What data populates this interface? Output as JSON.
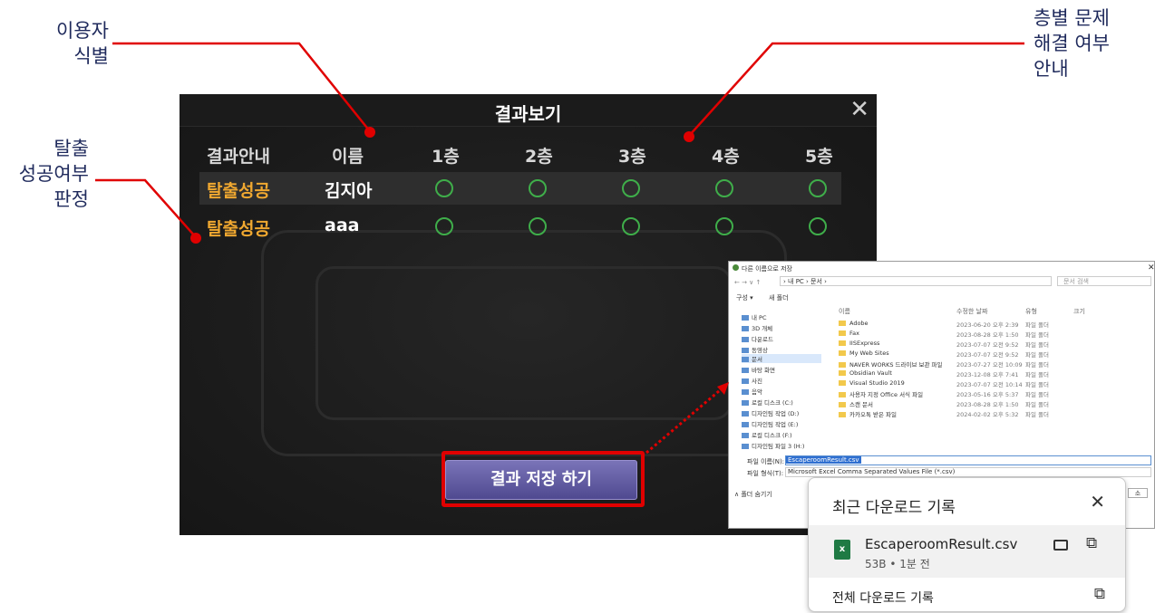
{
  "callouts": {
    "user_id": [
      "이용자",
      "식별"
    ],
    "floor_status": [
      "층별 문제",
      "해결 여부",
      "안내"
    ],
    "escape_result": [
      "탈출",
      "성공여부",
      "판정"
    ]
  },
  "game": {
    "title": "결과보기",
    "close": "✕",
    "headers": [
      "결과안내",
      "이름",
      "1층",
      "2층",
      "3층",
      "4층",
      "5층"
    ],
    "rows": [
      {
        "status": "탈출성공",
        "name": "김지아",
        "floors": [
          "O",
          "O",
          "O",
          "O",
          "O"
        ]
      },
      {
        "status": "탈출성공",
        "name": "aaa",
        "floors": [
          "O",
          "O",
          "O",
          "O",
          "O"
        ]
      }
    ],
    "save_button": "결과 저장 하기",
    "colors": {
      "status": "#f0a830",
      "circle": "#3fae4a",
      "highlight": "#e00000"
    }
  },
  "dialog": {
    "title": "다른 이름으로 저장",
    "path": "› 내 PC › 문서 ›",
    "search_placeholder": "문서 검색",
    "organize": "구성 ▾",
    "new_folder": "새 폴더",
    "col_name": "이름",
    "col_modified": "수정한 날짜",
    "col_type": "유형",
    "col_size": "크기",
    "sidebar": [
      "내 PC",
      "3D 개체",
      "다운로드",
      "동영상",
      "문서",
      "바탕 화면",
      "사진",
      "음악",
      "로컬 디스크 (C:)",
      "디자인팀 작업 (D:)",
      "디자인팀 작업 (E:)",
      "로컬 디스크 (F:)",
      "디자인팀 파일 3 (H:)"
    ],
    "files": [
      {
        "name": "Adobe",
        "date": "2023-06-20 오후 2:39",
        "type": "파일 폴더"
      },
      {
        "name": "Fax",
        "date": "2023-08-28 오후 1:50",
        "type": "파일 폴더"
      },
      {
        "name": "IISExpress",
        "date": "2023-07-07 오전 9:52",
        "type": "파일 폴더"
      },
      {
        "name": "My Web Sites",
        "date": "2023-07-07 오전 9:52",
        "type": "파일 폴더"
      },
      {
        "name": "NAVER WORKS 드라이브 보관 파일",
        "date": "2023-07-27 오전 10:09",
        "type": "파일 폴더"
      },
      {
        "name": "Obsidian Vault",
        "date": "2023-12-08 오후 7:41",
        "type": "파일 폴더"
      },
      {
        "name": "Visual Studio 2019",
        "date": "2023-07-07 오전 10:14",
        "type": "파일 폴더"
      },
      {
        "name": "사용자 지정 Office 서식 파일",
        "date": "2023-05-16 오후 5:37",
        "type": "파일 폴더"
      },
      {
        "name": "스캔 문서",
        "date": "2023-08-28 오후 1:50",
        "type": "파일 폴더"
      },
      {
        "name": "카카오톡 받은 파일",
        "date": "2024-02-02 오후 5:32",
        "type": "파일 폴더"
      }
    ],
    "filename_label": "파일 이름(N):",
    "filename_value": "EscaperoomResult.csv",
    "filetype_label": "파일 형식(T):",
    "filetype_value": "Microsoft Excel Comma Separated Values File (*.csv)",
    "hide_folders": "∧ 폴더 숨기기",
    "cancel_fragment": "소"
  },
  "downloads": {
    "title": "최근 다운로드 기록",
    "file": "EscaperoomResult.csv",
    "meta": "53B • 1분 전",
    "all": "전체 다운로드 기록",
    "icons": [
      "excel-file-icon",
      "folder-icon",
      "open-external-icon",
      "close-icon"
    ]
  }
}
